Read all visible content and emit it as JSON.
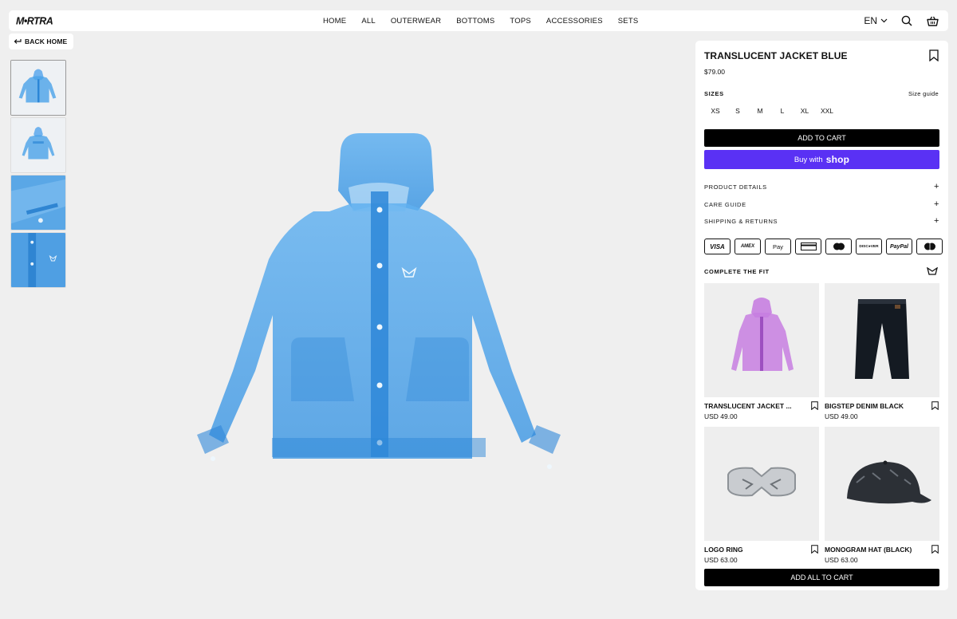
{
  "brand": {
    "logo_text": "M•RTRA"
  },
  "nav": [
    "HOME",
    "ALL",
    "OUTERWEAR",
    "BOTTOMS",
    "TOPS",
    "ACCESSORIES",
    "SETS"
  ],
  "header": {
    "lang": "EN"
  },
  "back_label": "BACK HOME",
  "product": {
    "title": "TRANSLUCENT JACKET BLUE",
    "price": "$79.00",
    "sizes_label": "SIZES",
    "size_guide": "Size guide",
    "sizes": [
      "XS",
      "S",
      "M",
      "L",
      "XL",
      "XXL"
    ],
    "add_to_cart": "ADD TO CART",
    "buy_with": "Buy with",
    "shop_word": "shop",
    "accordions": [
      "PRODUCT DETAILS",
      "CARE GUIDE",
      "SHIPPING & RETURNS"
    ],
    "plus": "+"
  },
  "payments": [
    "VISA",
    "AMEX",
    "Apple Pay",
    "card",
    "mastercard",
    "DISCOVER",
    "PayPal",
    "maestro"
  ],
  "payment_text": {
    "visa": "VISA",
    "amex": "AMEX",
    "apple": "Pay",
    "discover": "DISC●VER",
    "paypal": "PayPal"
  },
  "complete_fit": {
    "label": "COMPLETE THE FIT",
    "items": [
      {
        "name": "TRANSLUCENT JACKET ...",
        "price": "USD 49.00"
      },
      {
        "name": "BIGSTEP DENIM BLACK",
        "price": "USD 49.00"
      },
      {
        "name": "LOGO RING",
        "price": "USD 63.00"
      },
      {
        "name": "MONOGRAM HAT (BLACK)",
        "price": "USD 63.00"
      }
    ],
    "add_all": "ADD ALL TO CART"
  },
  "colors": {
    "accent_shop": "#5a31f4",
    "jacket_blue": "#4aa3e8",
    "jacket_purple": "#c77ee0"
  }
}
